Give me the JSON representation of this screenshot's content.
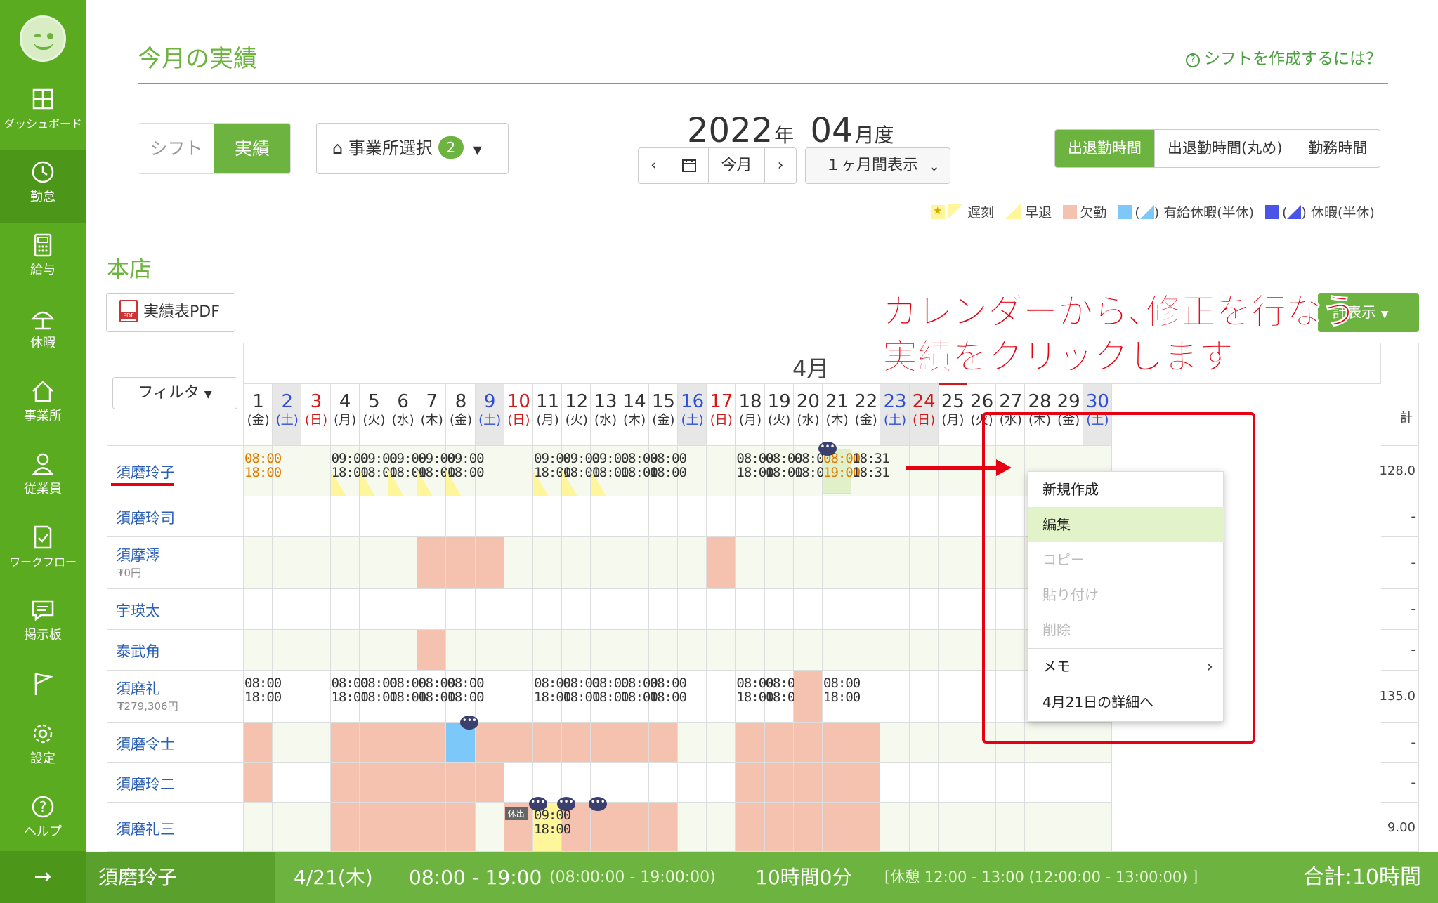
{
  "sidebar": {
    "items": [
      {
        "label": "ダッシュボード",
        "icon": "dashboard-icon"
      },
      {
        "label": "勤怠",
        "icon": "clock-icon"
      },
      {
        "label": "給与",
        "icon": "calculator-icon"
      },
      {
        "label": "休暇",
        "icon": "umbrella-icon"
      },
      {
        "label": "事業所",
        "icon": "home-icon"
      },
      {
        "label": "従業員",
        "icon": "person-icon"
      },
      {
        "label": "ワークフロー",
        "icon": "checklist-icon"
      },
      {
        "label": "掲示板",
        "icon": "message-icon"
      },
      {
        "label": "",
        "icon": "flag-icon"
      },
      {
        "label": "設定",
        "icon": "gear-icon"
      },
      {
        "label": "ヘルプ",
        "icon": "help-icon"
      }
    ],
    "bottom_arrow": "→"
  },
  "header": {
    "title": "今月の実績",
    "help_link": "シフトを作成するには？"
  },
  "toolbar": {
    "mode_shift": "シフト",
    "mode_actual": "実績",
    "office_select": "事業所選択",
    "office_count": "2",
    "year": "2022",
    "year_unit": "年",
    "month": "04",
    "month_unit": "月度",
    "prev": "‹",
    "next": "›",
    "today": "今月",
    "period": "１ヶ月間表示",
    "view_options": [
      "出退勤時間",
      "出退勤時間(丸め)",
      "勤務時間"
    ],
    "view_active": "出退勤時間"
  },
  "legend": {
    "late": "遅刻",
    "early_leave": "早退",
    "absence": "欠勤",
    "paid_leave": "有給休暇(半休)",
    "leave": "休暇(半休)",
    "paren_open": "(",
    "paren_close": ")",
    "colors": {
      "late": "#fff59a",
      "absence": "#f6c2b0",
      "paid_leave": "#7cc8f8",
      "leave": "#4a55e8"
    }
  },
  "section": {
    "title": "本店",
    "pdf_button": "実績表PDF",
    "pdf_badge": "PDF",
    "total_button": "計表示"
  },
  "table": {
    "filter": "フィルタ",
    "month_label": "4月",
    "total_header": "計",
    "days": [
      {
        "d": "1",
        "w": "(金)"
      },
      {
        "d": "2",
        "w": "(土)"
      },
      {
        "d": "3",
        "w": "(日)"
      },
      {
        "d": "4",
        "w": "(月)"
      },
      {
        "d": "5",
        "w": "(火)"
      },
      {
        "d": "6",
        "w": "(水)"
      },
      {
        "d": "7",
        "w": "(木)"
      },
      {
        "d": "8",
        "w": "(金)"
      },
      {
        "d": "9",
        "w": "(土)"
      },
      {
        "d": "10",
        "w": "(日)"
      },
      {
        "d": "11",
        "w": "(月)"
      },
      {
        "d": "12",
        "w": "(火)"
      },
      {
        "d": "13",
        "w": "(水)"
      },
      {
        "d": "14",
        "w": "(木)"
      },
      {
        "d": "15",
        "w": "(金)"
      },
      {
        "d": "16",
        "w": "(土)"
      },
      {
        "d": "17",
        "w": "(日)"
      },
      {
        "d": "18",
        "w": "(月)"
      },
      {
        "d": "19",
        "w": "(火)"
      },
      {
        "d": "20",
        "w": "(水)"
      },
      {
        "d": "21",
        "w": "(木)"
      },
      {
        "d": "22",
        "w": "(金)"
      },
      {
        "d": "23",
        "w": "(土)"
      },
      {
        "d": "24",
        "w": "(日)"
      },
      {
        "d": "25",
        "w": "(月)"
      },
      {
        "d": "26",
        "w": "(火)"
      },
      {
        "d": "27",
        "w": "(水)"
      },
      {
        "d": "28",
        "w": "(木)"
      },
      {
        "d": "29",
        "w": "(金)"
      },
      {
        "d": "30",
        "w": "(土)"
      }
    ],
    "employees": [
      {
        "name": "須磨玲子",
        "sub": "",
        "total": "128.0"
      },
      {
        "name": "須磨玲司",
        "sub": "",
        "total": "-"
      },
      {
        "name": "須摩澪",
        "sub": "₮0円",
        "total": "-"
      },
      {
        "name": "宇瑛太",
        "sub": "",
        "total": "-"
      },
      {
        "name": "泰武角",
        "sub": "",
        "total": "-"
      },
      {
        "name": "須磨礼",
        "sub": "₮279,306円",
        "total": "135.0"
      },
      {
        "name": "須磨令士",
        "sub": "",
        "total": "-"
      },
      {
        "name": "須磨玲二",
        "sub": "",
        "total": "-"
      },
      {
        "name": "須磨礼三",
        "sub": "",
        "total": "9.00"
      }
    ],
    "times": {
      "late_in": "08:00",
      "late_out": "18:00",
      "in_0900": "09:00",
      "in_0800": "08:00",
      "out_1800": "18:00",
      "out_1831": "18:31",
      "out_1900": "19:00",
      "holiday_work_tag": "休出"
    }
  },
  "context_menu": {
    "items": [
      "新規作成",
      "編集",
      "コピー",
      "貼り付け",
      "削除",
      "メモ",
      "4月21日の詳細へ"
    ],
    "submenu_arrow": "›"
  },
  "annotation": {
    "line1": "カレンダーから､修正を行なう",
    "line2": "実績をクリックします。"
  },
  "statusbar": {
    "name": "須磨玲子",
    "date": "4/21(木)",
    "time": "08:00 - 19:00",
    "time_precise": "(08:00:00 - 19:00:00)",
    "duration": "10時間0分",
    "break": "[休憩 12:00 - 13:00 (12:00:00 - 13:00:00) ]",
    "total": "合計:10時間"
  }
}
